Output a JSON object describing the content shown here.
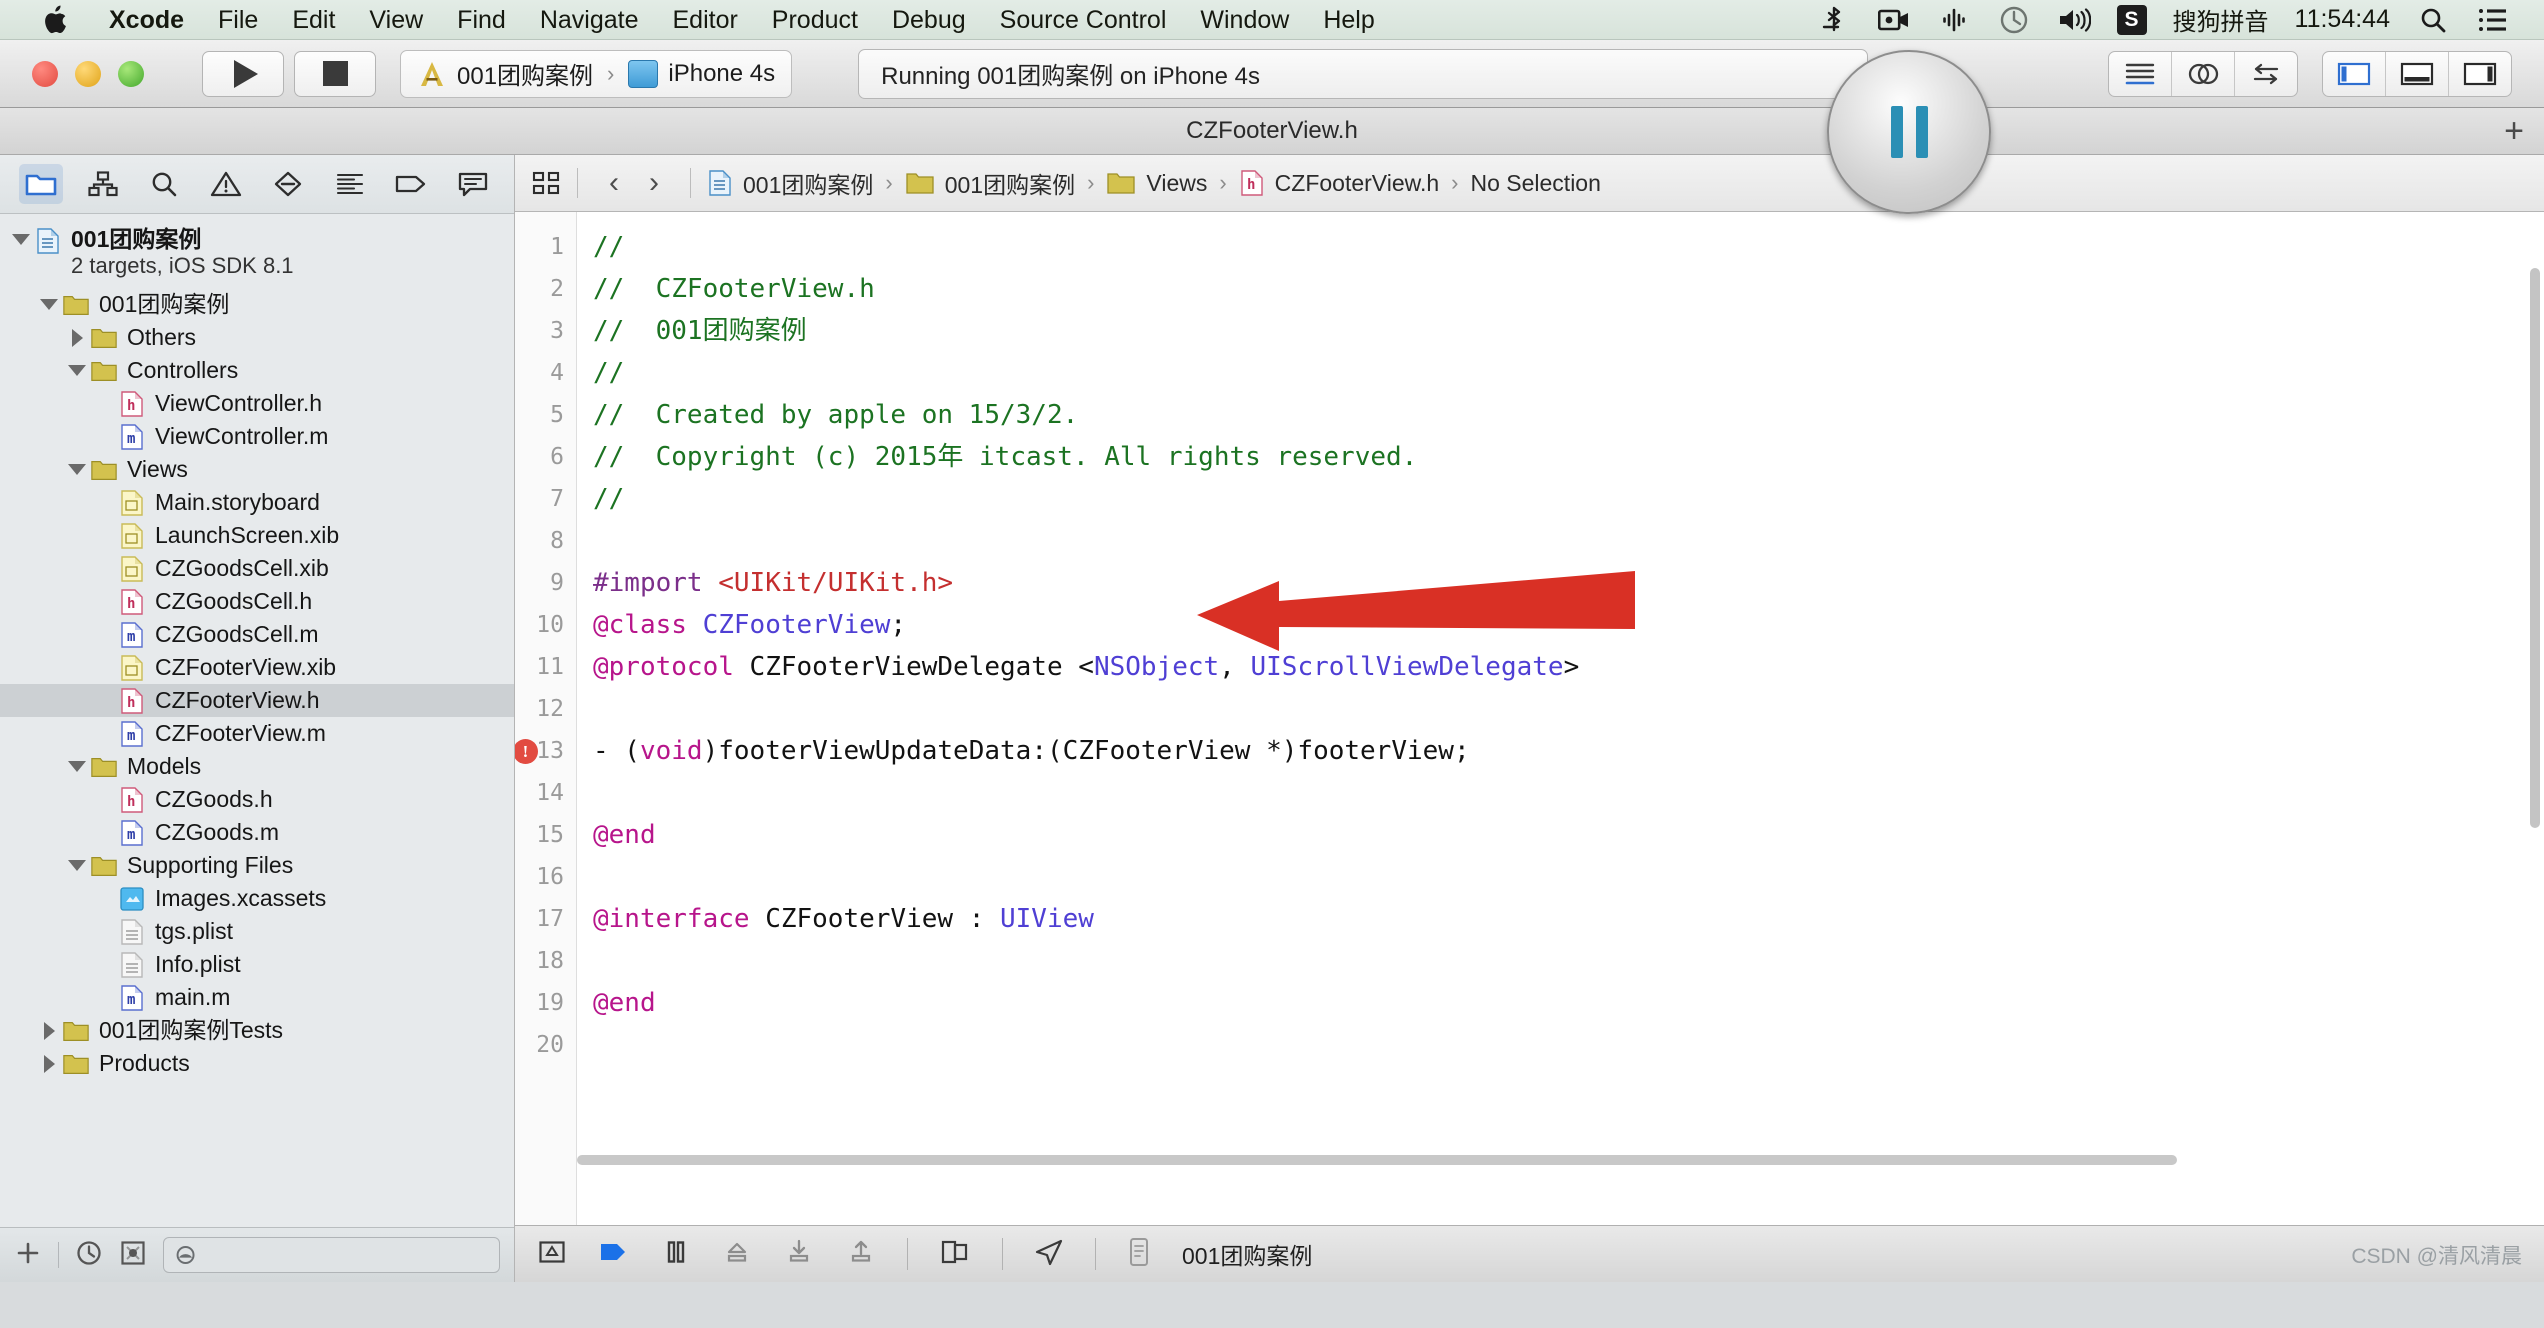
{
  "menubar": {
    "apple_icon": "apple-logo",
    "items": [
      {
        "label": "Xcode",
        "bold": true
      },
      {
        "label": "File",
        "bold": false
      },
      {
        "label": "Edit",
        "bold": false
      },
      {
        "label": "View",
        "bold": false
      },
      {
        "label": "Find",
        "bold": false
      },
      {
        "label": "Navigate",
        "bold": false
      },
      {
        "label": "Editor",
        "bold": false
      },
      {
        "label": "Product",
        "bold": false
      },
      {
        "label": "Debug",
        "bold": false
      },
      {
        "label": "Source Control",
        "bold": false
      },
      {
        "label": "Window",
        "bold": false
      },
      {
        "label": "Help",
        "bold": false
      }
    ],
    "status_icons": [
      "bluetooth-icon",
      "screen-recorder-icon",
      "airplay-icon",
      "time-machine-icon",
      "volume-icon"
    ],
    "input_method_badge": "S",
    "input_method_label": "搜狗拼音",
    "clock": "11:54:44",
    "spotlight_icon": "search-icon",
    "notification_icon": "notification-center-icon"
  },
  "toolbar": {
    "window_controls": [
      "close-button",
      "minimize-button",
      "zoom-button"
    ],
    "run_icon": "play-icon",
    "stop_icon": "stop-icon",
    "scheme_name": "001团购案例",
    "scheme_separator": "›",
    "destination_name": "iPhone 4s",
    "status_text": "Running 001团购案例 on iPhone 4s",
    "pause_button_icon": "pause-icon",
    "right_buttons": [
      "standard-editor-icon",
      "assistant-editor-icon",
      "version-editor-icon"
    ],
    "panel_buttons": [
      "toggle-navigator-icon",
      "toggle-debug-area-icon",
      "toggle-utilities-icon"
    ]
  },
  "editor_title": {
    "text": "CZFooterView.h",
    "add_tab_icon": "plus-icon"
  },
  "navigator": {
    "toolbar_icons": [
      "project-navigator-icon",
      "symbol-navigator-icon",
      "find-navigator-icon",
      "issue-navigator-icon",
      "test-navigator-icon",
      "debug-navigator-icon",
      "breakpoint-navigator-icon",
      "report-navigator-icon"
    ],
    "active_toolbar_index": 0,
    "project": {
      "name": "001团购案例",
      "subtitle": "2 targets, iOS SDK 8.1"
    },
    "tree": [
      {
        "label": "001团购案例",
        "indent": 1,
        "disc": "down",
        "icon": "folder",
        "selected": false
      },
      {
        "label": "Others",
        "indent": 2,
        "disc": "right",
        "icon": "folder",
        "selected": false
      },
      {
        "label": "Controllers",
        "indent": 2,
        "disc": "down",
        "icon": "folder",
        "selected": false
      },
      {
        "label": "ViewController.h",
        "indent": 3,
        "disc": "none",
        "icon": "h",
        "selected": false
      },
      {
        "label": "ViewController.m",
        "indent": 3,
        "disc": "none",
        "icon": "m",
        "selected": false
      },
      {
        "label": "Views",
        "indent": 2,
        "disc": "down",
        "icon": "folder",
        "selected": false
      },
      {
        "label": "Main.storyboard",
        "indent": 3,
        "disc": "none",
        "icon": "ib",
        "selected": false
      },
      {
        "label": "LaunchScreen.xib",
        "indent": 3,
        "disc": "none",
        "icon": "xib",
        "selected": false
      },
      {
        "label": "CZGoodsCell.xib",
        "indent": 3,
        "disc": "none",
        "icon": "xib",
        "selected": false
      },
      {
        "label": "CZGoodsCell.h",
        "indent": 3,
        "disc": "none",
        "icon": "h",
        "selected": false
      },
      {
        "label": "CZGoodsCell.m",
        "indent": 3,
        "disc": "none",
        "icon": "m",
        "selected": false
      },
      {
        "label": "CZFooterView.xib",
        "indent": 3,
        "disc": "none",
        "icon": "xib",
        "selected": false
      },
      {
        "label": "CZFooterView.h",
        "indent": 3,
        "disc": "none",
        "icon": "h",
        "selected": true
      },
      {
        "label": "CZFooterView.m",
        "indent": 3,
        "disc": "none",
        "icon": "m",
        "selected": false
      },
      {
        "label": "Models",
        "indent": 2,
        "disc": "down",
        "icon": "folder",
        "selected": false
      },
      {
        "label": "CZGoods.h",
        "indent": 3,
        "disc": "none",
        "icon": "h",
        "selected": false
      },
      {
        "label": "CZGoods.m",
        "indent": 3,
        "disc": "none",
        "icon": "m",
        "selected": false
      },
      {
        "label": "Supporting Files",
        "indent": 2,
        "disc": "down",
        "icon": "folder",
        "selected": false
      },
      {
        "label": "Images.xcassets",
        "indent": 3,
        "disc": "none",
        "icon": "assets",
        "selected": false
      },
      {
        "label": "tgs.plist",
        "indent": 3,
        "disc": "none",
        "icon": "plist",
        "selected": false
      },
      {
        "label": "Info.plist",
        "indent": 3,
        "disc": "none",
        "icon": "plist",
        "selected": false
      },
      {
        "label": "main.m",
        "indent": 3,
        "disc": "none",
        "icon": "m",
        "selected": false
      },
      {
        "label": "001团购案例Tests",
        "indent": 1,
        "disc": "right",
        "icon": "folder",
        "selected": false
      },
      {
        "label": "Products",
        "indent": 1,
        "disc": "right",
        "icon": "folder",
        "selected": false
      }
    ],
    "footer_icons": [
      "add-icon",
      "recent-files-icon",
      "source-control-filter-icon"
    ],
    "filter_placeholder": ""
  },
  "jumpbar": {
    "related_items_icon": "related-items-icon",
    "back_icon": "‹",
    "forward_icon": "›",
    "crumbs": [
      {
        "label": "001团购案例",
        "icon": "project-icon"
      },
      {
        "label": "001团购案例",
        "icon": "folder-icon"
      },
      {
        "label": "Views",
        "icon": "folder-icon"
      },
      {
        "label": "CZFooterView.h",
        "icon": "header-file-icon"
      },
      {
        "label": "No Selection",
        "icon": "none"
      }
    ],
    "chevron": "›"
  },
  "code": {
    "first_line_number": 1,
    "error_line": 13,
    "error_marker": "!",
    "lines": [
      {
        "n": 1,
        "tokens": [
          {
            "t": "//",
            "c": "comment"
          }
        ]
      },
      {
        "n": 2,
        "tokens": [
          {
            "t": "//  CZFooterView.h",
            "c": "comment"
          }
        ]
      },
      {
        "n": 3,
        "tokens": [
          {
            "t": "//  001团购案例",
            "c": "comment"
          }
        ]
      },
      {
        "n": 4,
        "tokens": [
          {
            "t": "//",
            "c": "comment"
          }
        ]
      },
      {
        "n": 5,
        "tokens": [
          {
            "t": "//  Created by apple on 15/3/2.",
            "c": "comment"
          }
        ]
      },
      {
        "n": 6,
        "tokens": [
          {
            "t": "//  Copyright (c) 2015年 itcast. All rights reserved.",
            "c": "comment"
          }
        ]
      },
      {
        "n": 7,
        "tokens": [
          {
            "t": "//",
            "c": "comment"
          }
        ]
      },
      {
        "n": 8,
        "tokens": []
      },
      {
        "n": 9,
        "tokens": [
          {
            "t": "#import ",
            "c": "pre"
          },
          {
            "t": "<UIKit/UIKit.h>",
            "c": "string"
          }
        ]
      },
      {
        "n": 10,
        "tokens": [
          {
            "t": "@class ",
            "c": "kw"
          },
          {
            "t": "CZFooterView",
            "c": "type"
          },
          {
            "t": ";",
            "c": "plain"
          }
        ]
      },
      {
        "n": 11,
        "tokens": [
          {
            "t": "@protocol ",
            "c": "kw"
          },
          {
            "t": "CZFooterViewDelegate ",
            "c": "plain"
          },
          {
            "t": "<",
            "c": "plain"
          },
          {
            "t": "NSObject",
            "c": "type"
          },
          {
            "t": ", ",
            "c": "plain"
          },
          {
            "t": "UIScrollViewDelegate",
            "c": "type"
          },
          {
            "t": ">",
            "c": "plain"
          }
        ]
      },
      {
        "n": 12,
        "tokens": []
      },
      {
        "n": 13,
        "tokens": [
          {
            "t": "- (",
            "c": "plain"
          },
          {
            "t": "void",
            "c": "kw"
          },
          {
            "t": ")footerViewUpdateData:(CZFooterView *)footerView;",
            "c": "plain"
          }
        ]
      },
      {
        "n": 14,
        "tokens": []
      },
      {
        "n": 15,
        "tokens": [
          {
            "t": "@end",
            "c": "kw"
          }
        ]
      },
      {
        "n": 16,
        "tokens": []
      },
      {
        "n": 17,
        "tokens": [
          {
            "t": "@interface ",
            "c": "kw"
          },
          {
            "t": "CZFooterView ",
            "c": "plain"
          },
          {
            "t": ": ",
            "c": "plain"
          },
          {
            "t": "UIView",
            "c": "type"
          }
        ]
      },
      {
        "n": 18,
        "tokens": []
      },
      {
        "n": 19,
        "tokens": [
          {
            "t": "@end",
            "c": "kw"
          }
        ]
      },
      {
        "n": 20,
        "tokens": []
      }
    ],
    "annotation": {
      "type": "red-arrow",
      "points_to_line": 10,
      "color": "#d93025"
    }
  },
  "debug_bar": {
    "icons": [
      "toggle-debug-area-icon",
      "continue-icon",
      "pause-icon",
      "step-over-icon",
      "step-into-icon",
      "step-out-icon",
      "view-hierarchy-icon",
      "location-simulate-icon",
      "process-icon"
    ],
    "process_label": "001团购案例"
  },
  "watermark": "CSDN @清风清晨",
  "colors": {
    "accent": "#2b8fb5",
    "comment_green": "#1c7322",
    "keyword_magenta": "#b7158b",
    "type_purple": "#4f3fd4",
    "string_red": "#c42f2f",
    "preprocessor_purple": "#7b2f8a",
    "error_red": "#e24b41",
    "arrow_red": "#d93025",
    "menubar_bg": "#e3ece6",
    "navigator_bg": "#e7eaec",
    "selected_row": "#ccd0d3"
  }
}
